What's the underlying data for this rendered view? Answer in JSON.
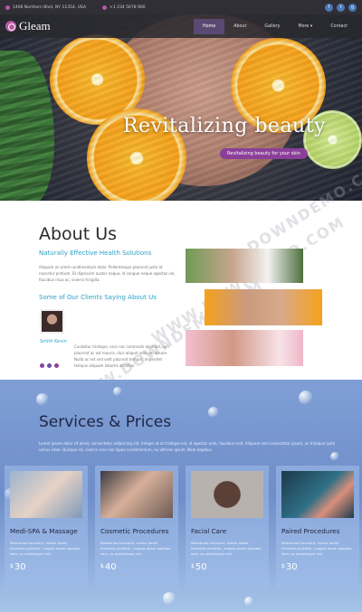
{
  "topbar": {
    "address": "1406 Northern Blvd, NY 11354, USA",
    "phone": "+1 234 5678 900",
    "socials": [
      "f",
      "t",
      "g"
    ]
  },
  "nav": {
    "logo": "Gleam",
    "items": [
      {
        "label": "Home",
        "active": true
      },
      {
        "label": "About",
        "active": false
      },
      {
        "label": "Gallery",
        "active": false
      },
      {
        "label": "More",
        "active": false
      },
      {
        "label": "Contact",
        "active": false
      }
    ],
    "more_caret": "▾"
  },
  "hero": {
    "title": "Revitalizing beauty",
    "subtitle": "Revitalizing beauty for your skin"
  },
  "watermark": "WWW.DOWNDEMO.COM",
  "about": {
    "title": "About Us",
    "subtitle": "Naturally Effective Health Solutions",
    "paragraph": "Aliquam an amet condimentum dolor. Pellentesque placerat justo at nascetur pretium. Et dignissim auctor neque, id congue neque egestas vel, faucibus risus ac, viverra fringilla.",
    "clients_title": "Some of Our Clients Saying About Us",
    "testimonial": "Curabitur tristique, eros nec commodo eleifend, non placerat ac est mauris, duis aliquet odio vel ornare. Nulla ac est sed velit placerat tempor, imperdiet tempus aliquam lobortis et tellus.",
    "client_name": "Smith Kevin"
  },
  "services": {
    "title": "Services & Prices",
    "description": "Lorem ipsum dolor sit amet, consectetur adipiscing elit. Integer at ut tristique est, id egestas ante, faucibus erat. Aliquam sed consectetur ipsum, ac tristique justo varius vitae. Quisque sit, viverra eros non ligula condimentum, eu ultrices ipsum. Nam dapibus.",
    "cards": [
      {
        "title": "Medi-SPA & Massage",
        "text": "Maecenas tincidunt, metus lorem tincidunt porttitor, magna quam egestas sem, ac scelerisque nisl.",
        "currency": "$",
        "price": "30"
      },
      {
        "title": "Cosmetic Procedures",
        "text": "Maecenas tincidunt, metus lorem tincidunt porttitor, magna quam egestas sem, ac scelerisque nisl.",
        "currency": "$",
        "price": "40"
      },
      {
        "title": "Facial Care",
        "text": "Maecenas tincidunt, metus lorem tincidunt porttitor, magna quam egestas sem, ac scelerisque nisl.",
        "currency": "$",
        "price": "50"
      },
      {
        "title": "Paired Procedures",
        "text": "Maecenas tincidunt, metus lorem tincidunt porttitor, magna quam egestas sem, ac scelerisque nisl.",
        "currency": "$",
        "price": "30"
      }
    ]
  },
  "colors": {
    "accent": "#8b3f9a",
    "link": "#2aa2c6",
    "topbar": "#2f2f35"
  }
}
